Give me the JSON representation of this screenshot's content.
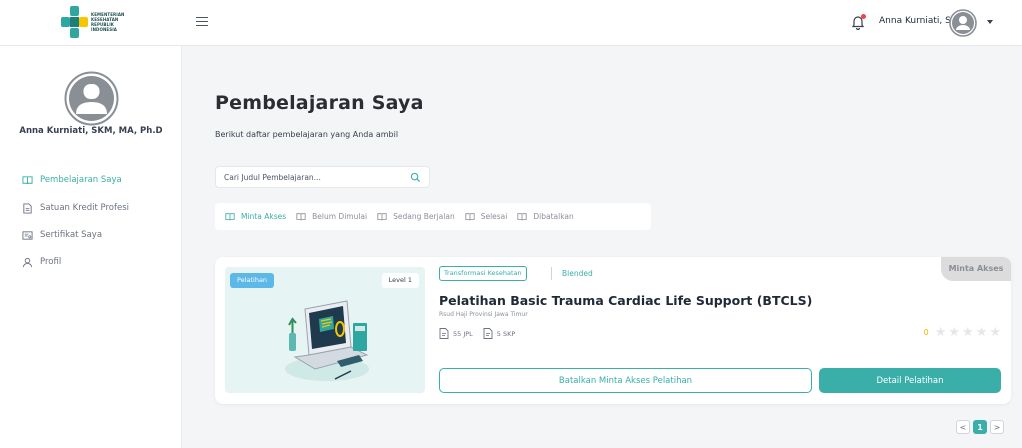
{
  "header": {
    "logo_text": "KEMENTERIAN\nKESEHATAN\nREPUBLIK\nINDONESIA",
    "user_name": "Anna Kurniati, S ..."
  },
  "sidebar": {
    "profile_name": "Anna Kurniati, SKM, MA, Ph.D",
    "items": [
      {
        "label": "Pembelajaran Saya",
        "icon": "book-open-icon",
        "active": true
      },
      {
        "label": "Satuan Kredit Profesi",
        "icon": "document-icon",
        "active": false
      },
      {
        "label": "Sertifikat Saya",
        "icon": "certificate-icon",
        "active": false
      },
      {
        "label": "Profil",
        "icon": "user-icon",
        "active": false
      }
    ]
  },
  "main": {
    "title": "Pembelajaran Saya",
    "subtitle": "Berikut daftar pembelajaran yang Anda ambil",
    "search": {
      "placeholder": "Cari Judul Pembelajaran..."
    },
    "tabs": [
      {
        "label": "Minta Akses",
        "active": true
      },
      {
        "label": "Belum Dimulai",
        "active": false
      },
      {
        "label": "Sedang Berjalan",
        "active": false
      },
      {
        "label": "Selesai",
        "active": false
      },
      {
        "label": "Dibatalkan",
        "active": false
      }
    ]
  },
  "course": {
    "type_badge": "Pelatihan",
    "level": "Level 1",
    "category": "Transformasi Kesehatan",
    "mode": "Blended",
    "status": "Minta Akses",
    "title": "Pelatihan Basic Trauma Cardiac Life Support (BTCLS)",
    "organizer": "Rsud Haji Provinsi Jawa Timur",
    "jpl": "55 JPL",
    "skp": "5 SKP",
    "rating": "0",
    "stars_total": 5,
    "cancel_label": "Batalkan Minta Akses Pelatihan",
    "detail_label": "Detail Pelatihan"
  },
  "pagination": {
    "prev": "<",
    "current": "1",
    "next": ">"
  },
  "colors": {
    "accent": "#3aaea8",
    "badge_blue": "#5bb8e8",
    "star": "#f5b301",
    "notification": "#ef4444"
  }
}
